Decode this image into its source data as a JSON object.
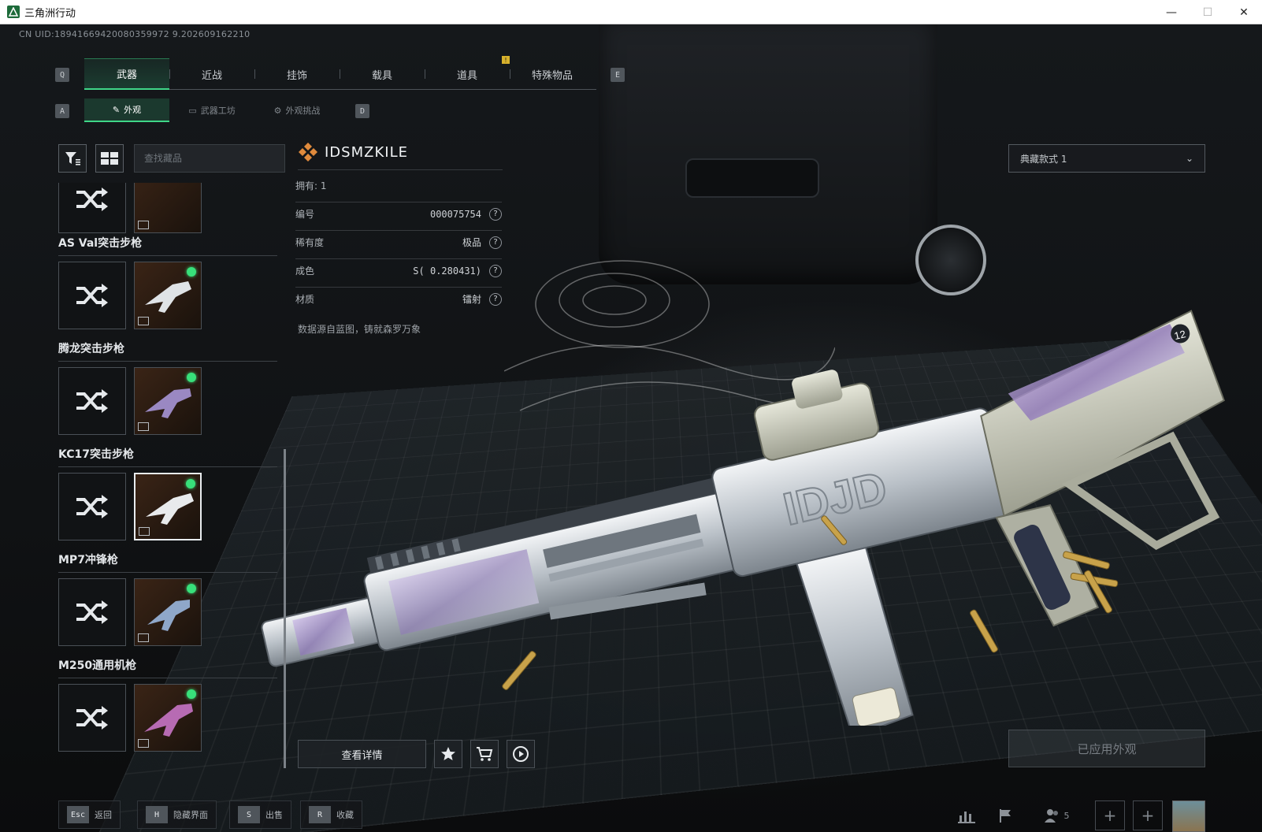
{
  "window": {
    "title": "三角洲行动"
  },
  "uid": "CN UID:18941669420080359972 9.202609162210",
  "tabs": {
    "left_key": "Q",
    "right_key": "E",
    "items": [
      "武器",
      "近战",
      "挂饰",
      "载具",
      "道具",
      "特殊物品"
    ],
    "alert": "!"
  },
  "subtabs": {
    "left_key": "A",
    "right_key": "D",
    "items": [
      "外观",
      "武器工坊",
      "外观挑战"
    ]
  },
  "search": {
    "placeholder": "查找藏品"
  },
  "weapons": [
    {
      "name": "AS Val突击步枪"
    },
    {
      "name": "腾龙突击步枪"
    },
    {
      "name": "KC17突击步枪"
    },
    {
      "name": "MP7冲锋枪"
    },
    {
      "name": "M250通用机枪"
    }
  ],
  "skin": {
    "name": "IDSMZKILE",
    "owned": "拥有: 1",
    "props": [
      {
        "label": "编号",
        "value": "000075754"
      },
      {
        "label": "稀有度",
        "value": "极品"
      },
      {
        "label": "成色",
        "value": "S( 0.280431)"
      },
      {
        "label": "材质",
        "value": "镭射"
      }
    ],
    "description": "数据源自蓝图，铸就森罗万象",
    "q": "?"
  },
  "dropdown": {
    "value": "典藏款式 1"
  },
  "actions": {
    "view_details": "查看详情",
    "applied": "已应用外观"
  },
  "hints": [
    {
      "key": "Esc",
      "label": "返回"
    },
    {
      "key": "H",
      "label": "隐藏界面"
    },
    {
      "key": "S",
      "label": "出售"
    },
    {
      "key": "R",
      "label": "收藏"
    }
  ],
  "friends_count": "5",
  "colors": {
    "accent": "#3fd688",
    "online_dot": "#38e07a"
  }
}
